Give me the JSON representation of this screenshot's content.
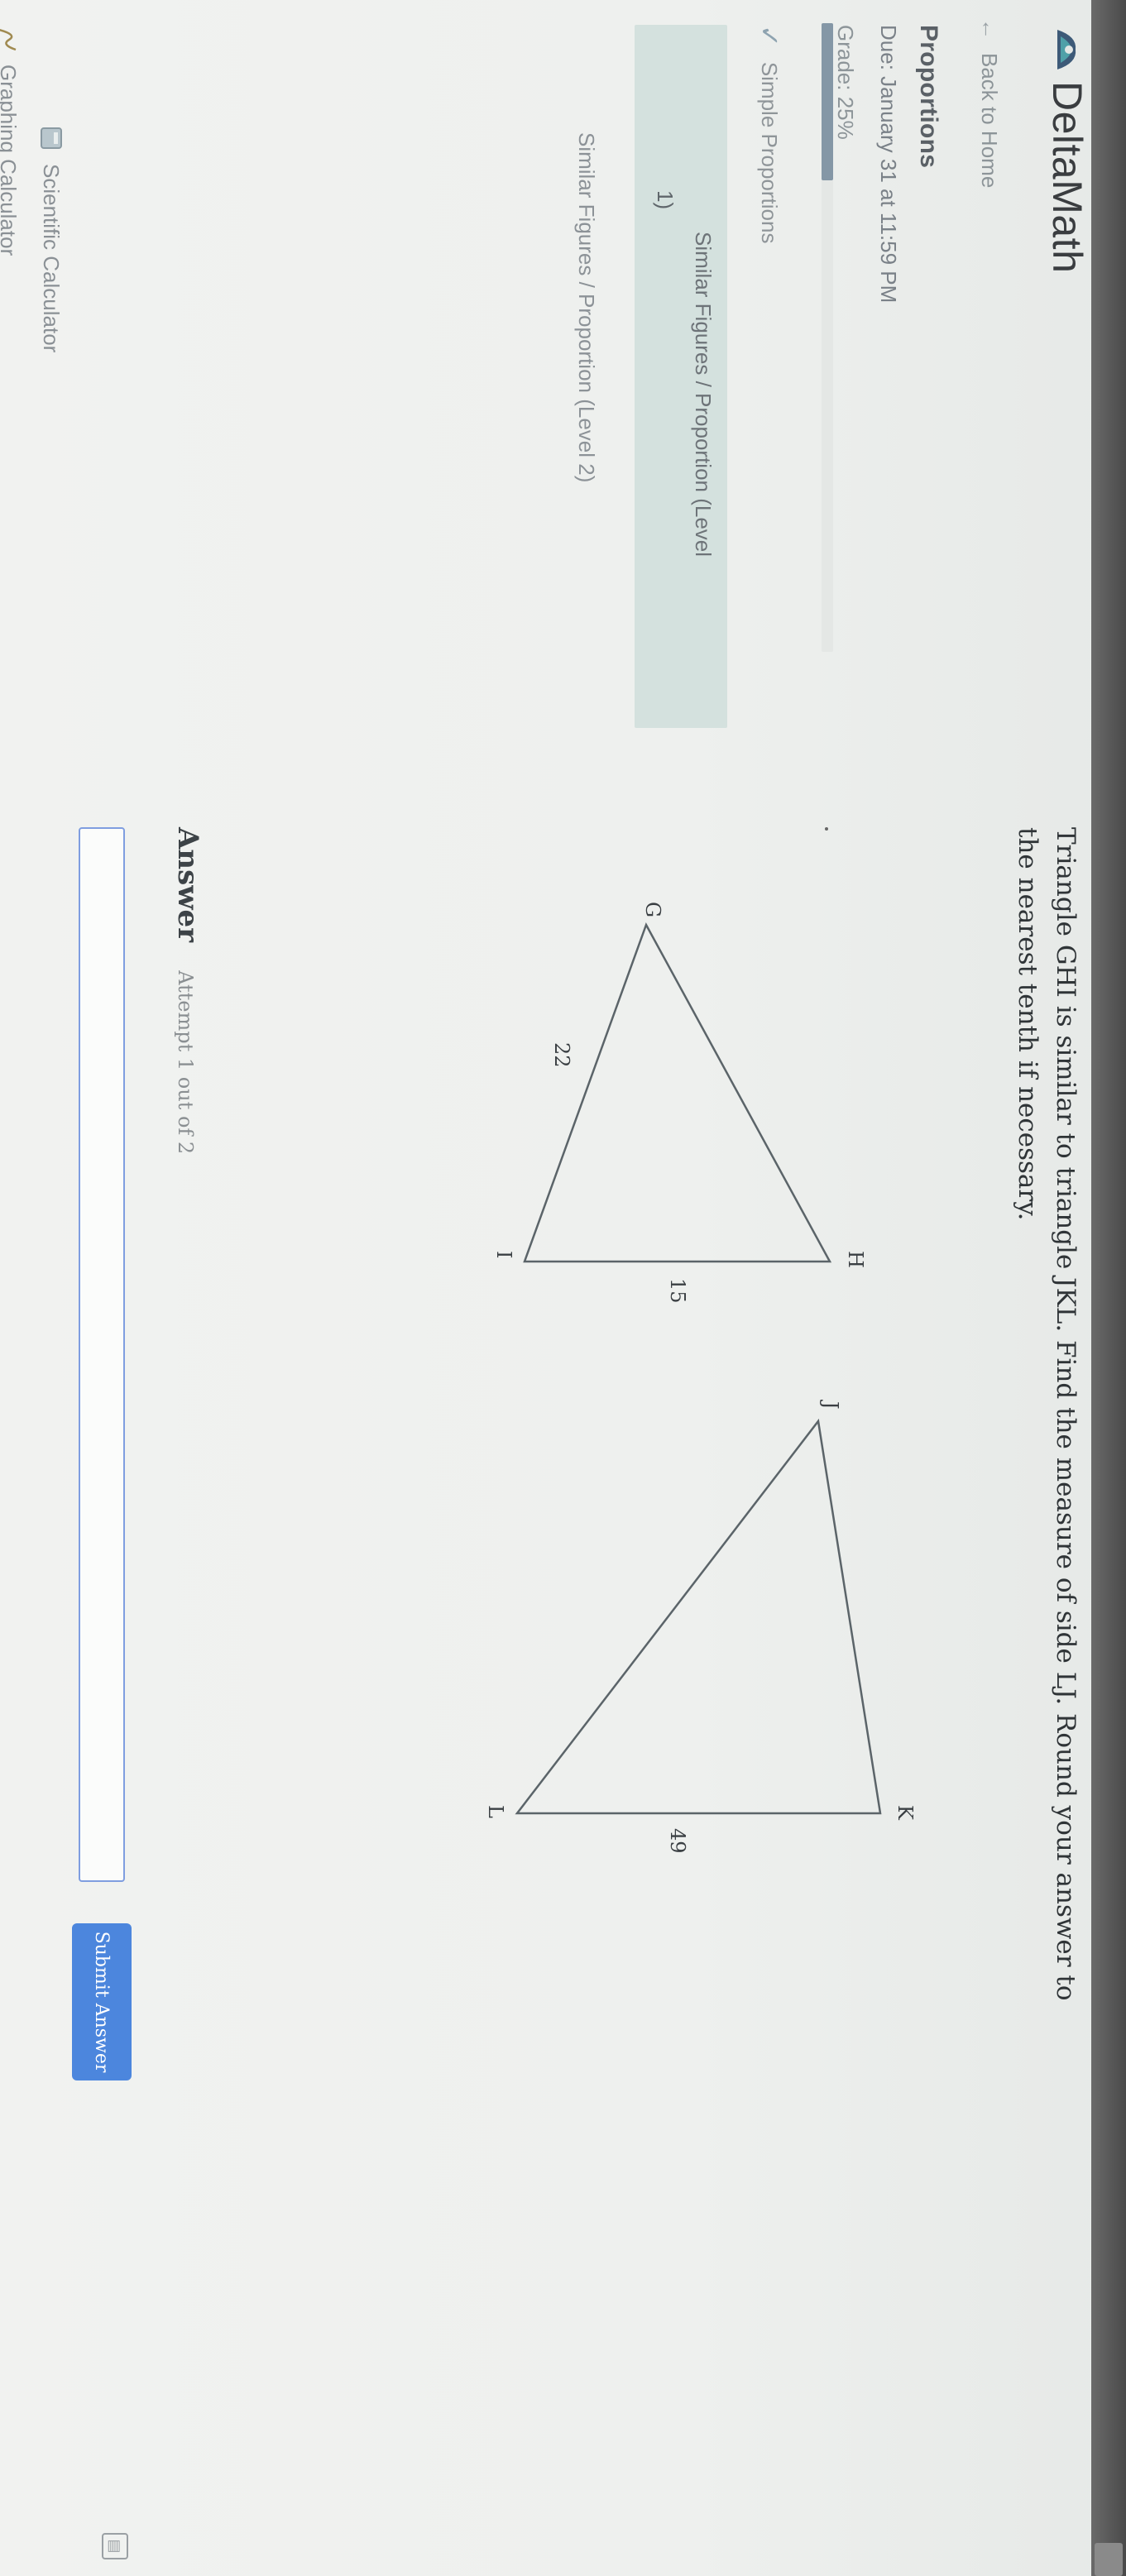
{
  "app": {
    "name": "DeltaMath"
  },
  "sidebar": {
    "back_label": "Back to Home",
    "assignment_title": "Proportions",
    "due": "Due: January 31 at 11:59 PM",
    "grade": "Grade: 25%",
    "grade_progress": 0.25,
    "skills": [
      {
        "label": "Simple Proportions",
        "completed": true
      },
      {
        "label": "Similar Figures / Proportion (Level",
        "number": "1)",
        "current": true
      }
    ],
    "level_line": "Similar Figures / Proportion (Level 2)",
    "tools": [
      {
        "label": "Scientific Calculator",
        "icon": "calculator-icon"
      },
      {
        "label": "Graphing Calculator",
        "icon": "graph-icon"
      }
    ]
  },
  "problem": {
    "question_line1": "Triangle GHI is similar to triangle JKL. Find the measure of side LJ. Round your answer to",
    "question_line2": "the nearest tenth if necessary.",
    "triangle_small": {
      "vertices": [
        "G",
        "H",
        "I"
      ],
      "side_labels": [
        "22",
        "15"
      ]
    },
    "triangle_large": {
      "vertices": [
        "J",
        "K",
        "L"
      ],
      "side_labels": [
        "49"
      ]
    }
  },
  "answer": {
    "label": "Answer",
    "attempt": "Attempt 1 out of 2",
    "value": "",
    "placeholder": "",
    "submit_label": "Submit Answer"
  },
  "colors": {
    "accent": "#4c86dd",
    "input_border": "#7f9ee0",
    "current_skill_bg": "#d4e1de"
  }
}
